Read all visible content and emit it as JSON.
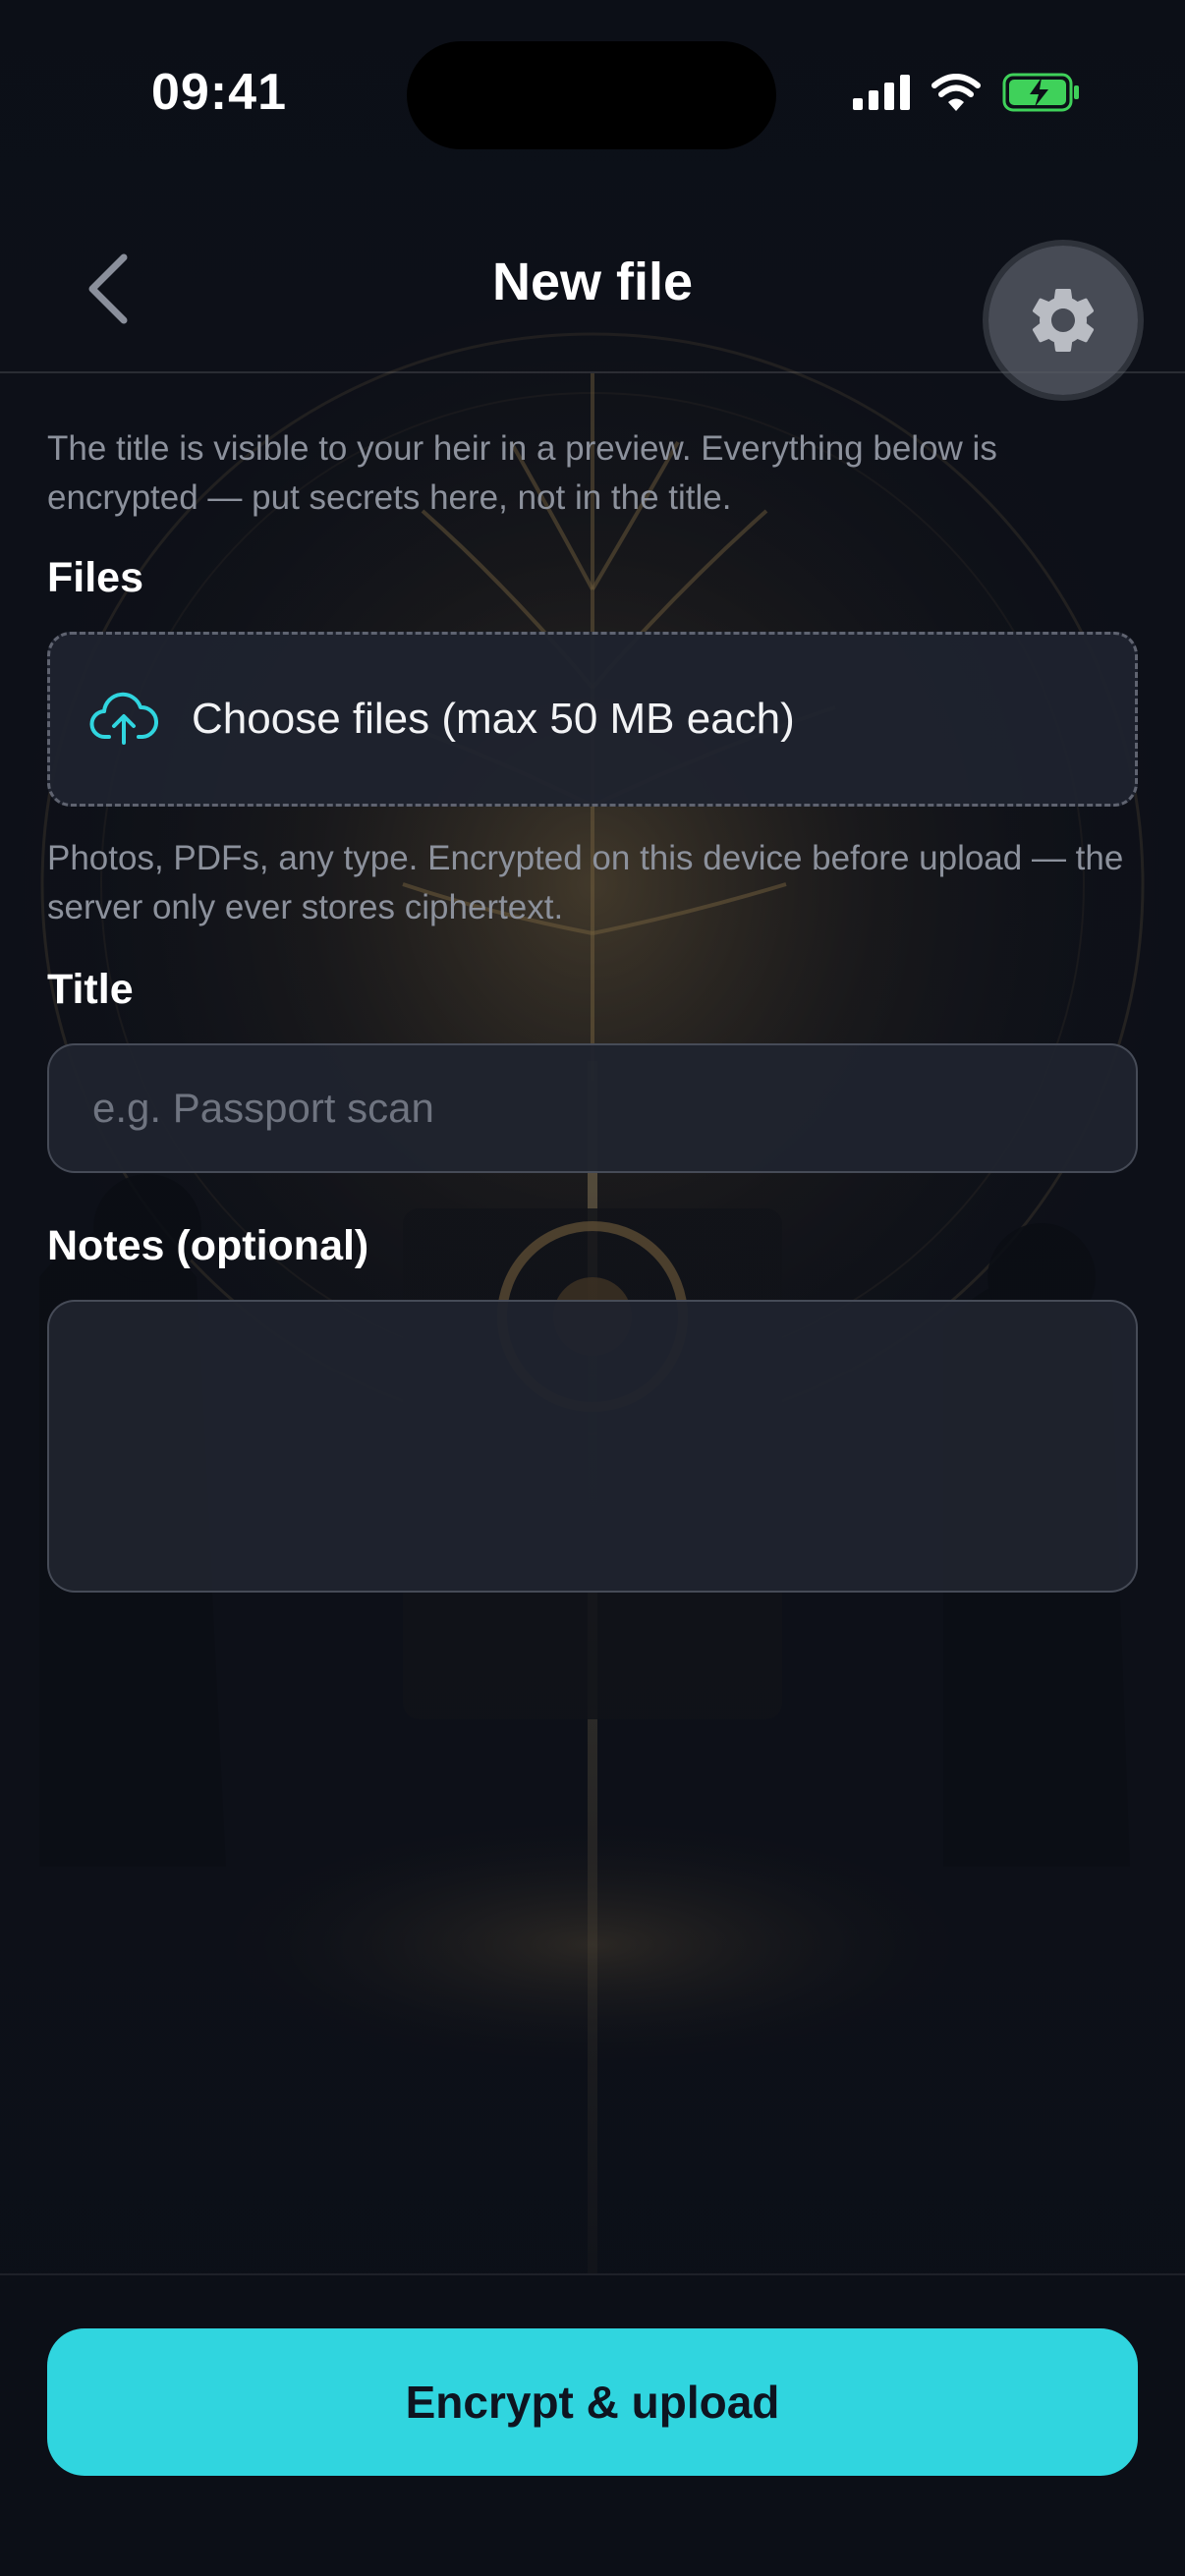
{
  "status_bar": {
    "time": "09:41",
    "icons": [
      "cellular-signal-icon",
      "wifi-icon",
      "battery-charging-icon"
    ]
  },
  "header": {
    "title": "New file",
    "back_icon": "chevron-left-icon",
    "settings_icon": "gear-icon"
  },
  "intro": {
    "text": "The title is visible to your heir in a preview. Everything below is encrypted — put secrets here, not in the title."
  },
  "files": {
    "label": "Files",
    "picker_icon": "cloud-upload-icon",
    "picker_label": "Choose files (max 50 MB each)",
    "help": "Photos, PDFs, any type. Encrypted on this device before upload — the server only ever stores ciphertext."
  },
  "title_field": {
    "label": "Title",
    "placeholder": "e.g. Passport scan",
    "value": ""
  },
  "notes_field": {
    "label": "Notes (optional)",
    "value": ""
  },
  "primary_action": {
    "label": "Encrypt & upload"
  },
  "colors": {
    "background": "#0c0f17",
    "field_background": "#1f232e",
    "accent": "#30d5df",
    "muted_text": "#8c919c",
    "battery": "#3fd15a"
  }
}
